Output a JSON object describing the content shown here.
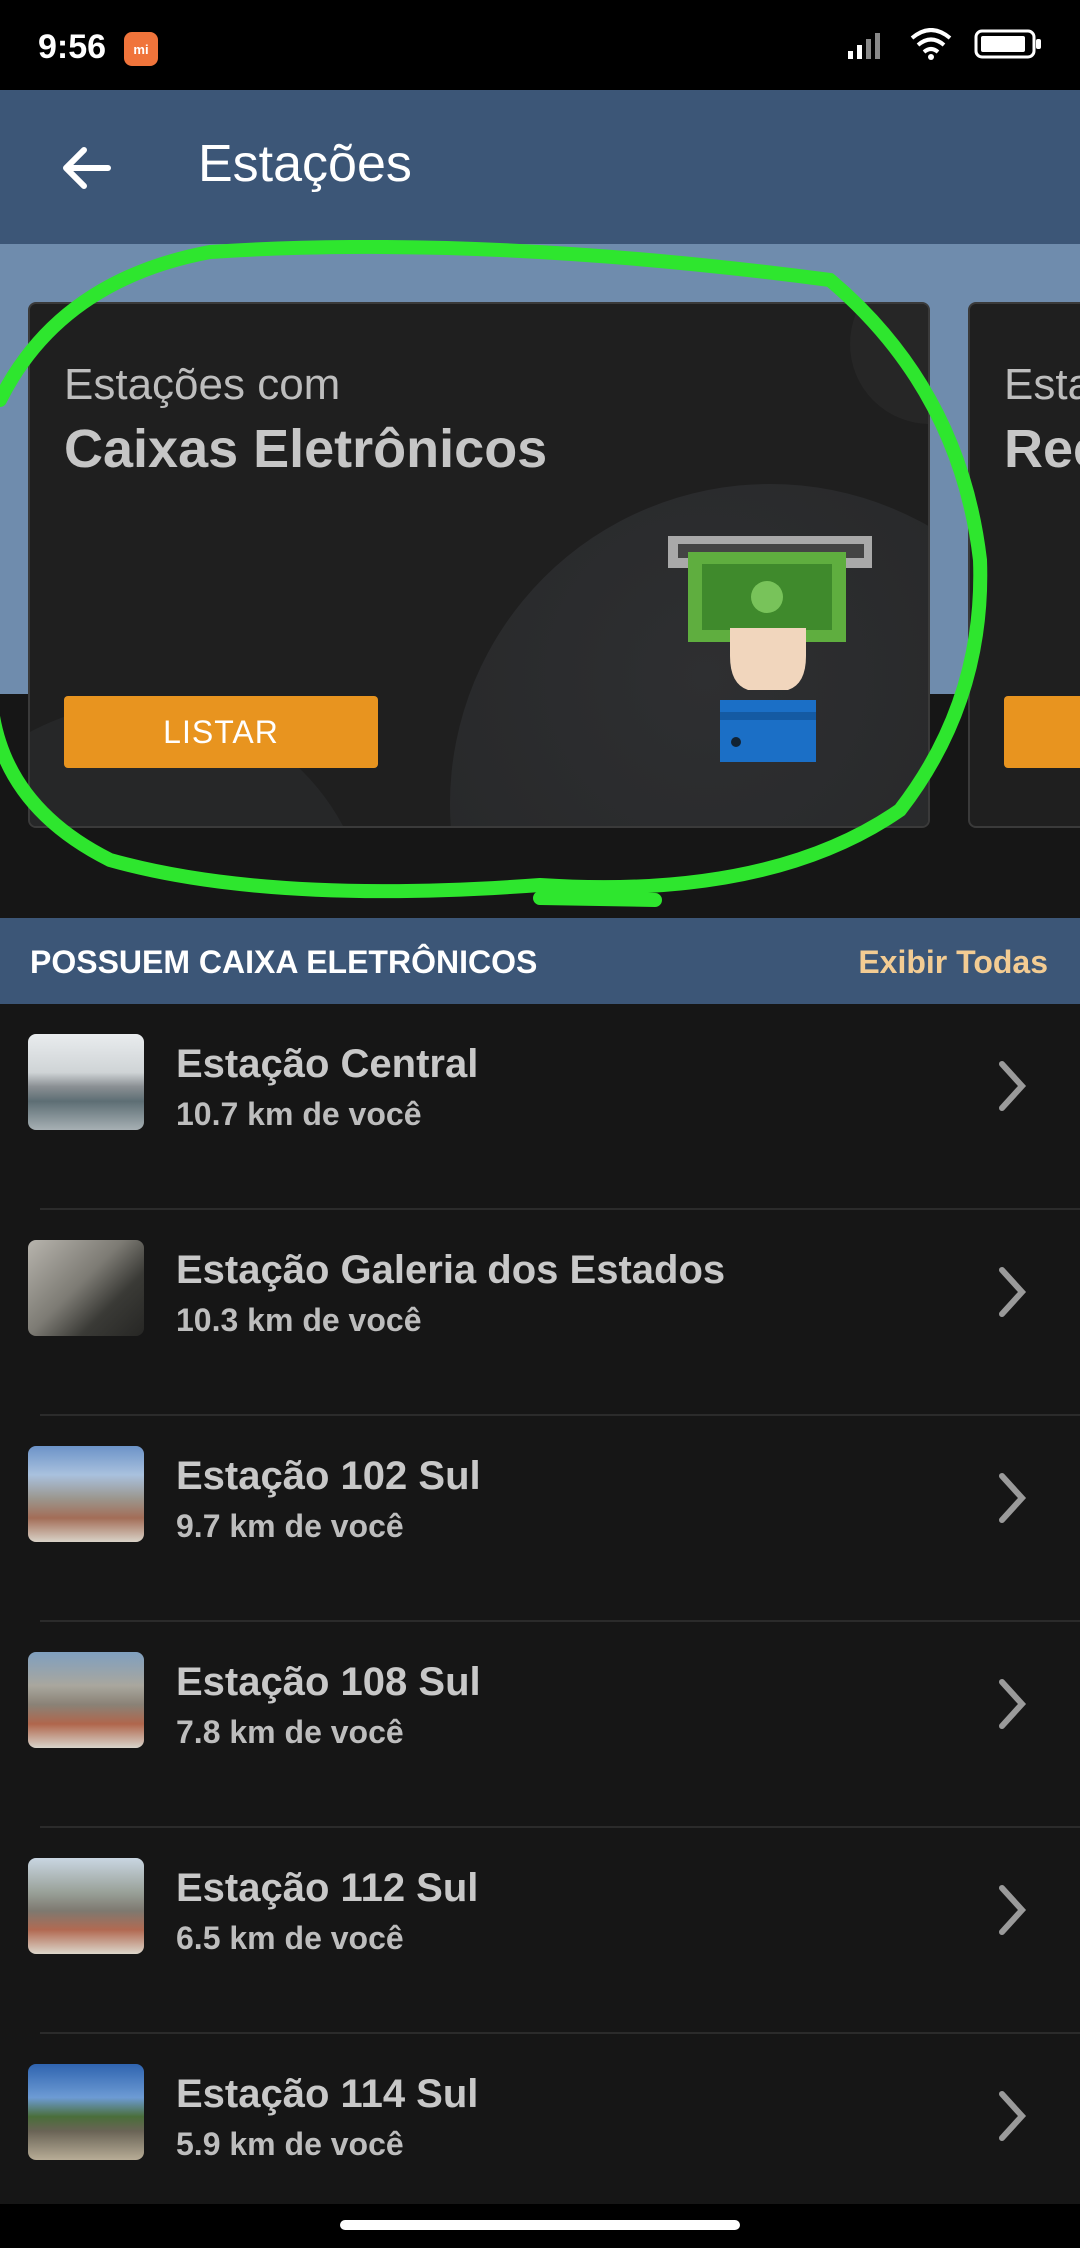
{
  "status_bar": {
    "time": "9:56",
    "badge": "mi"
  },
  "app_bar": {
    "title": "Estações"
  },
  "carousel": {
    "cards": [
      {
        "subtitle": "Estações com",
        "title": "Caixas Eletrônicos",
        "button_label": "LISTAR"
      },
      {
        "subtitle": "Esta",
        "title": "Rec"
      }
    ]
  },
  "section": {
    "title": "POSSUEM CAIXA ELETRÔNICOS",
    "link_label": "Exibir Todas"
  },
  "stations": [
    {
      "name": "Estação Central",
      "distance": "10.7 km de você"
    },
    {
      "name": "Estação Galeria dos Estados",
      "distance": "10.3 km de você"
    },
    {
      "name": "Estação 102 Sul",
      "distance": "9.7 km de você"
    },
    {
      "name": "Estação 108 Sul",
      "distance": "7.8 km de você"
    },
    {
      "name": "Estação 112 Sul",
      "distance": "6.5 km de você"
    },
    {
      "name": "Estação 114 Sul",
      "distance": "5.9 km de você"
    }
  ],
  "colors": {
    "app_bar": "#3c5677",
    "accent": "#e8941f",
    "link": "#f3cc93",
    "highlight": "#2ee62e"
  }
}
